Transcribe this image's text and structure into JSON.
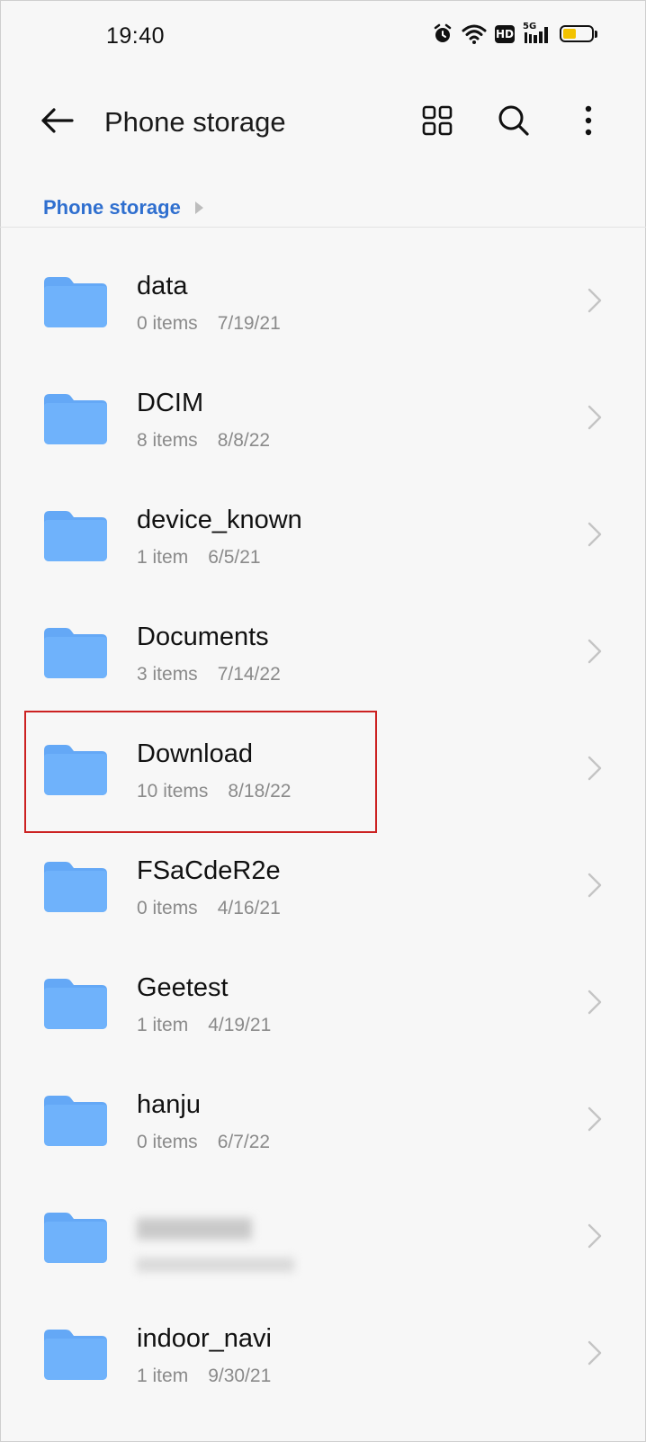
{
  "status_bar": {
    "time": "19:40",
    "icons": [
      "alarm-icon",
      "wifi-icon",
      "hd-icon",
      "5g-signal-icon",
      "battery-icon"
    ],
    "hd_label": "HD",
    "network_label": "5G",
    "battery_level": 0.45,
    "battery_color": "#f2c200"
  },
  "header": {
    "title": "Phone storage",
    "icons": [
      "back-arrow-icon",
      "grid-view-icon",
      "search-icon",
      "more-vert-icon"
    ]
  },
  "breadcrumb": {
    "current": "Phone storage",
    "color": "#2f6fcf"
  },
  "folders": [
    {
      "name": "data",
      "count": "0 items",
      "date": "7/19/21"
    },
    {
      "name": "DCIM",
      "count": "8 items",
      "date": "8/8/22"
    },
    {
      "name": "device_known",
      "count": "1 item",
      "date": "6/5/21"
    },
    {
      "name": "Documents",
      "count": "3 items",
      "date": "7/14/22"
    },
    {
      "name": "Download",
      "count": "10 items",
      "date": "8/18/22"
    },
    {
      "name": "FSaCdeR2e",
      "count": "0 items",
      "date": "4/16/21"
    },
    {
      "name": "Geetest",
      "count": "1 item",
      "date": "4/19/21"
    },
    {
      "name": "hanju",
      "count": "0 items",
      "date": "6/7/22"
    },
    {
      "name": "",
      "count": "",
      "date": ""
    },
    {
      "name": "indoor_navi",
      "count": "1 item",
      "date": "9/30/21"
    }
  ],
  "folder_color": "#64a8f6",
  "highlight_color": "#cc2222"
}
